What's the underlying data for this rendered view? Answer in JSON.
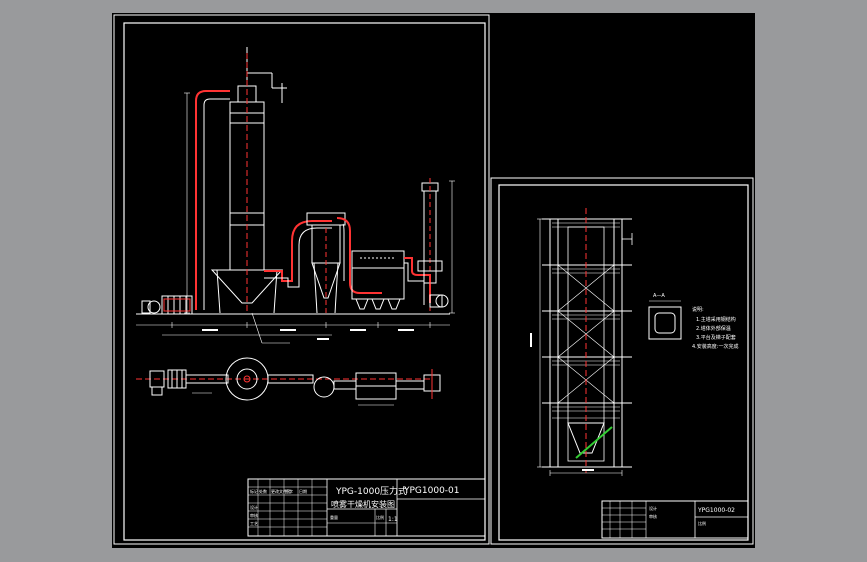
{
  "sheet1": {
    "title_line1": "YPG-1000压力式",
    "title_line2": "喷雾干燥机安装图",
    "drawing_no": "YPG1000-01",
    "scale": "1:1",
    "cell_labels": [
      "标记",
      "处数",
      "更改文件号",
      "签字",
      "日期",
      "设计",
      "审核",
      "工艺",
      "重量",
      "比例"
    ]
  },
  "sheet2": {
    "drawing_no": "YPG1000-02",
    "notes": {
      "heading": "说明:",
      "lines": [
        "1.主塔采用钢结构",
        "2.塔体外部保温",
        "3.平台及梯子配套",
        "4.安装高度:一次完成"
      ]
    },
    "detail_label": "A—A",
    "cell_labels": [
      "设计",
      "审核",
      "比例"
    ]
  },
  "colors": {
    "frame": "#ffffff",
    "pipe": "#ff3333",
    "equipment": "#ffffff",
    "highlight": "#33cc33",
    "grid": "#ffffff"
  }
}
